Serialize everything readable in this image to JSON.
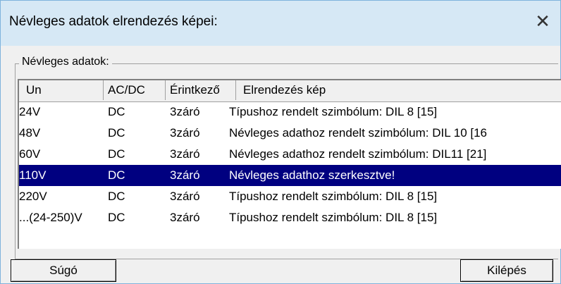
{
  "window": {
    "title": "Névleges adatok elrendezés képei:",
    "close_glyph": "✕"
  },
  "group": {
    "legend": "Névleges adatok:"
  },
  "table": {
    "headers": [
      "Un",
      "AC/DC",
      "Érintkező",
      "Elrendezés kép"
    ],
    "rows": [
      [
        "24V",
        "DC",
        "3záró",
        "Típushoz rendelt szimbólum: DIL 8 [15]"
      ],
      [
        "48V",
        "DC",
        "3záró",
        "Névleges adathoz rendelt szimbólum: DIL 10 [16"
      ],
      [
        "60V",
        "DC",
        "3záró",
        "Névleges adathoz rendelt szimbólum: DIL11 [21]"
      ],
      [
        "110V",
        "DC",
        "3záró",
        "Névleges adathoz szerkesztve!"
      ],
      [
        "220V",
        "DC",
        "3záró",
        "Típushoz rendelt szimbólum: DIL 8 [15]"
      ],
      [
        "...(24-250)V",
        "DC",
        "3záró",
        "Típushoz rendelt szimbólum: DIL 8 [15]"
      ]
    ],
    "selected_row": "110V"
  },
  "buttons": {
    "help_label": "Súgó",
    "exit_label": "Kilépés"
  },
  "colors": {
    "selection_bg": "#000080",
    "titlebar_bg": "#d6e8f5"
  }
}
